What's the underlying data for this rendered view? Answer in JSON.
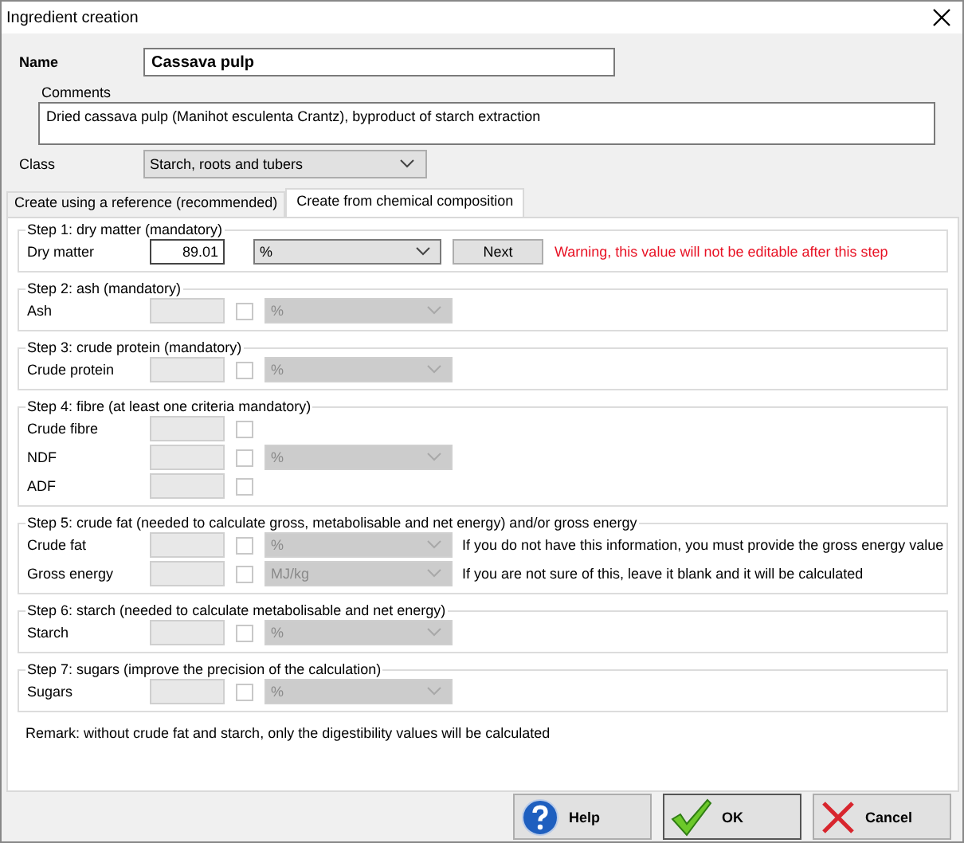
{
  "window": {
    "title": "Ingredient creation"
  },
  "name": {
    "label": "Name",
    "value": "Cassava pulp"
  },
  "comments": {
    "label": "Comments",
    "value": "Dried cassava pulp (Manihot esculenta Crantz), byproduct of starch extraction"
  },
  "class": {
    "label": "Class",
    "value": "Starch, roots and tubers"
  },
  "tabs": [
    {
      "label": "Create using a reference (recommended)",
      "selected": false
    },
    {
      "label": "Create from chemical composition",
      "selected": true
    }
  ],
  "steps": [
    {
      "title": "Step 1: dry matter (mandatory)",
      "rows": [
        {
          "label": "Dry matter",
          "value": "89.01",
          "disabled": false,
          "unit": "%",
          "button": "Next",
          "warning": "Warning, this value will not be editable after this step"
        }
      ]
    },
    {
      "title": "Step 2: ash (mandatory)",
      "rows": [
        {
          "label": "Ash",
          "disabled": true,
          "checked": false,
          "unit": "%"
        }
      ]
    },
    {
      "title": "Step 3: crude protein (mandatory)",
      "rows": [
        {
          "label": "Crude protein",
          "disabled": true,
          "checked": false,
          "unit": "%"
        }
      ]
    },
    {
      "title": "Step 4: fibre (at least one criteria mandatory)",
      "rows": [
        {
          "label": "Crude fibre",
          "disabled": true,
          "checked": false
        },
        {
          "label": "NDF",
          "disabled": true,
          "checked": false,
          "unit": "%"
        },
        {
          "label": "ADF",
          "disabled": true,
          "checked": false
        }
      ]
    },
    {
      "title": "Step 5: crude fat (needed to calculate gross, metabolisable and net energy) and/or gross energy",
      "rows": [
        {
          "label": "Crude fat",
          "disabled": true,
          "checked": false,
          "unit": "%",
          "note": "If you do not have this information, you must provide the gross energy value"
        },
        {
          "label": "Gross energy",
          "disabled": true,
          "checked": false,
          "unit": "MJ/kg",
          "note": "If you are not sure of this, leave it blank and it will be calculated"
        }
      ]
    },
    {
      "title": "Step 6: starch (needed to calculate metabolisable and net energy)",
      "rows": [
        {
          "label": "Starch",
          "disabled": true,
          "checked": false,
          "unit": "%"
        }
      ]
    },
    {
      "title": "Step 7: sugars (improve the precision of the calculation)",
      "rows": [
        {
          "label": "Sugars",
          "disabled": true,
          "checked": false,
          "unit": "%"
        }
      ]
    }
  ],
  "remark": "Remark: without crude fat and starch, only the digestibility values will be calculated",
  "buttons": [
    {
      "label": "Help",
      "kind": "help"
    },
    {
      "label": "OK",
      "kind": "ok"
    },
    {
      "label": "Cancel",
      "kind": "cancel"
    }
  ]
}
